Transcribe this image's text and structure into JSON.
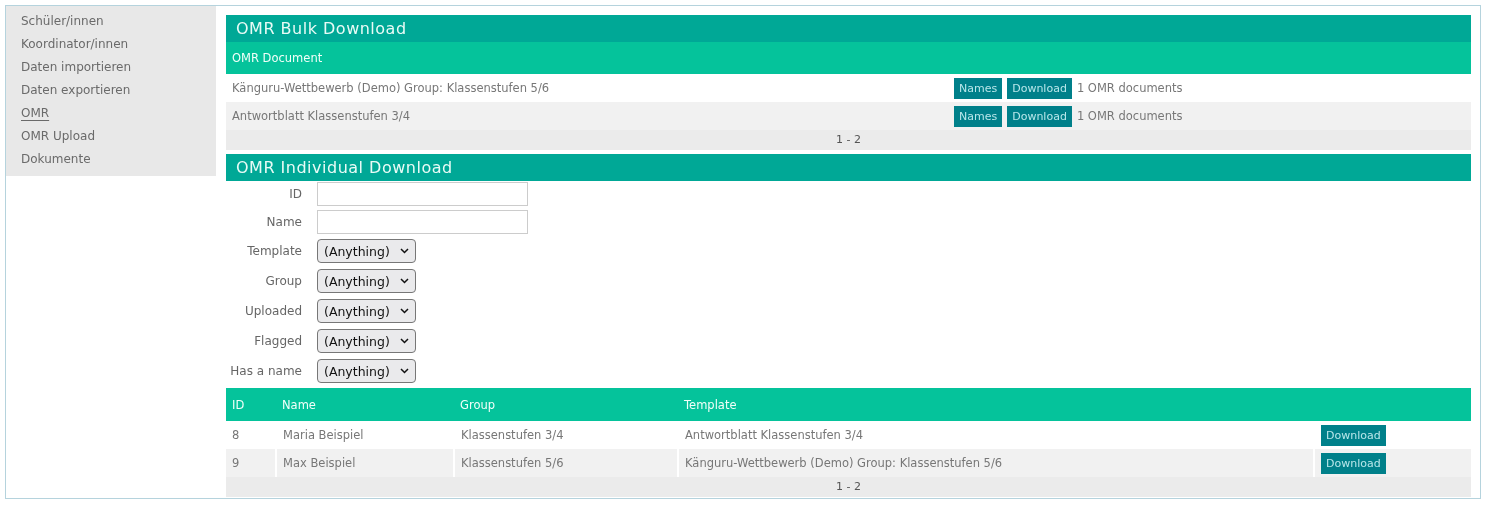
{
  "sidebar": {
    "items": [
      {
        "label": "Schüler/innen",
        "selected": false
      },
      {
        "label": "Koordinator/innen",
        "selected": false
      },
      {
        "label": "Daten importieren",
        "selected": false
      },
      {
        "label": "Daten exportieren",
        "selected": false
      },
      {
        "label": "OMR",
        "selected": true
      },
      {
        "label": "OMR Upload",
        "selected": false
      },
      {
        "label": "Dokumente",
        "selected": false
      }
    ]
  },
  "bulk_download": {
    "title": "OMR Bulk Download",
    "column": "OMR Document",
    "rows": [
      {
        "document": "Känguru-Wettbewerb (Demo) Group: Klassenstufen 5/6",
        "names_button": "Names",
        "download_button": "Download",
        "count": "1 OMR documents"
      },
      {
        "document": "Antwortblatt Klassenstufen 3/4",
        "names_button": "Names",
        "download_button": "Download",
        "count": "1 OMR documents"
      }
    ],
    "pager": "1 - 2"
  },
  "individual_download": {
    "title": "OMR Individual Download",
    "filters": [
      {
        "kind": "text",
        "label": "ID"
      },
      {
        "kind": "text",
        "label": "Name"
      },
      {
        "kind": "select",
        "label": "Template",
        "value": "(Anything)"
      },
      {
        "kind": "select",
        "label": "Group",
        "value": "(Anything)"
      },
      {
        "kind": "select",
        "label": "Uploaded",
        "value": "(Anything)"
      },
      {
        "kind": "select",
        "label": "Flagged",
        "value": "(Anything)"
      },
      {
        "kind": "select",
        "label": "Has a name",
        "value": "(Anything)"
      }
    ],
    "table": {
      "columns": [
        "ID",
        "Name",
        "Group",
        "Template"
      ],
      "rows": [
        {
          "cells": [
            "8",
            "Maria Beispiel",
            "Klassenstufen 3/4",
            "Antwortblatt Klassenstufen 3/4"
          ],
          "action": "Download"
        },
        {
          "cells": [
            "9",
            "Max Beispiel",
            "Klassenstufen 5/6",
            "Känguru-Wettbewerb (Demo) Group: Klassenstufen 5/6"
          ],
          "action": "Download"
        }
      ]
    },
    "pager": "1 - 2"
  }
}
